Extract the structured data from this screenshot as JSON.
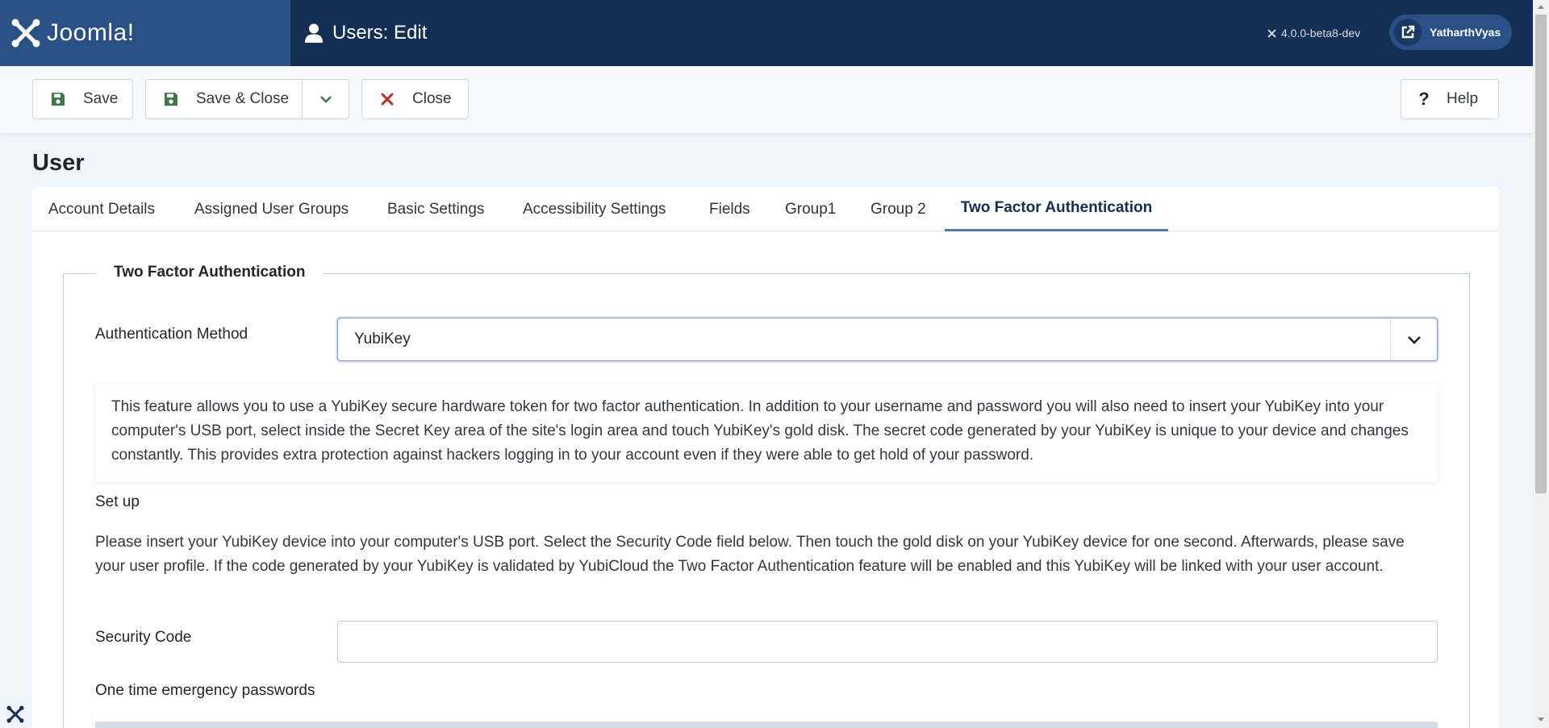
{
  "header": {
    "brand": "Joomla!",
    "page_heading": "Users: Edit",
    "version": "4.0.0-beta8-dev",
    "user": "YatharthVyas",
    "colors": {
      "header_bg": "#132f53",
      "logo_bg": "#2a5186"
    }
  },
  "toolbar": {
    "save_label": "Save",
    "save_close_label": "Save & Close",
    "close_label": "Close",
    "help_label": "Help"
  },
  "page": {
    "title": "User"
  },
  "tabs": [
    {
      "label": "Account Details"
    },
    {
      "label": "Assigned User Groups"
    },
    {
      "label": "Basic Settings"
    },
    {
      "label": "Accessibility Settings"
    },
    {
      "label": "Fields"
    },
    {
      "label": "Group1"
    },
    {
      "label": "Group 2"
    },
    {
      "label": "Two Factor Authentication",
      "active": true
    }
  ],
  "tfa": {
    "legend": "Two Factor Authentication",
    "method_label": "Authentication Method",
    "method_value": "YubiKey",
    "info": "This feature allows you to use a YubiKey secure hardware token for two factor authentication. In addition to your username and password you will also need to insert your YubiKey into your computer's USB port, select inside the Secret Key area of the site's login area and touch YubiKey's gold disk. The secret code generated by your YubiKey is unique to your device and changes constantly. This provides extra protection against hackers logging in to your account even if they were able to get hold of your password.",
    "setup_heading": "Set up",
    "setup_text": "Please insert your YubiKey device into your computer's USB port. Select the Security Code field below. Then touch the gold disk on your YubiKey device for one second. Afterwards, please save your user profile. If the code generated by your YubiKey is validated by YubiCloud the Two Factor Authentication feature will be enabled and this YubiKey will be linked with your user account.",
    "security_code_label": "Security Code",
    "security_code_value": "",
    "emergency_label": "One time emergency passwords"
  }
}
